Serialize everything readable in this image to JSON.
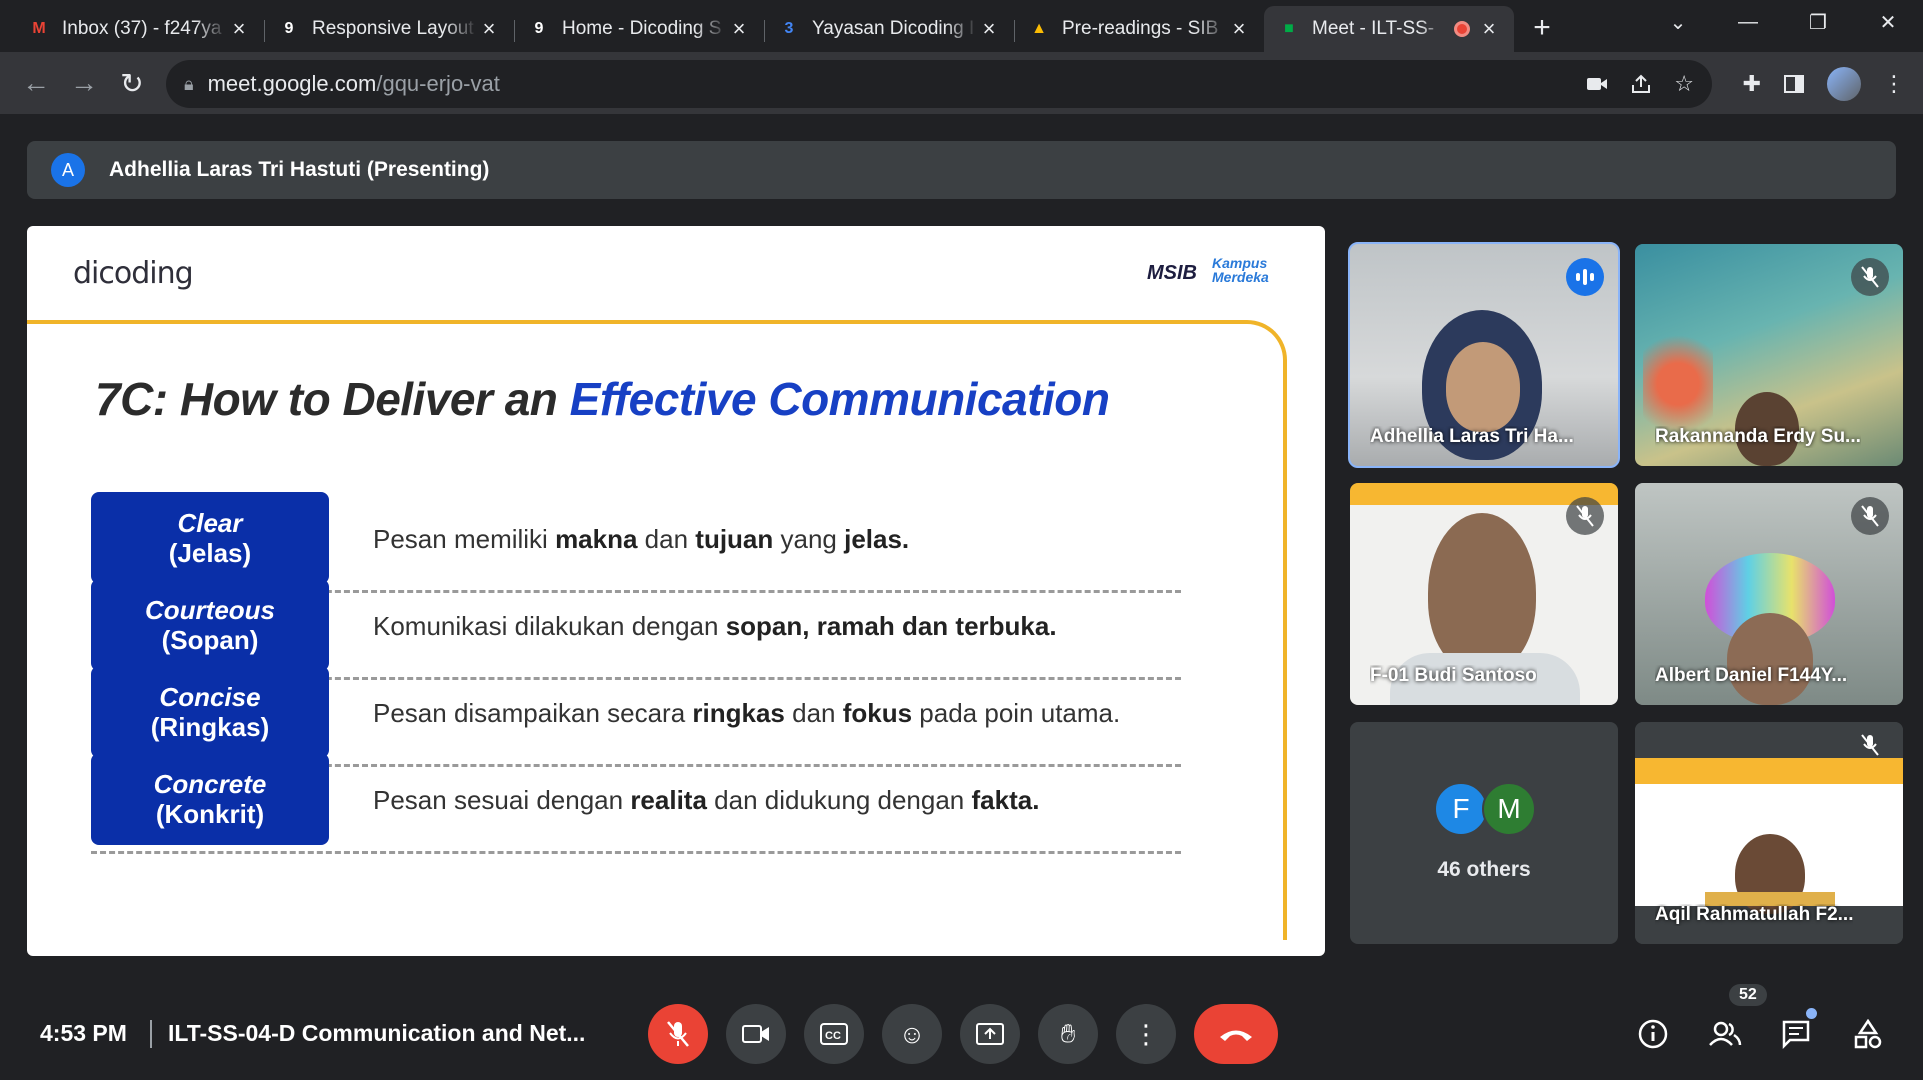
{
  "browser": {
    "tabs": [
      {
        "title": "Inbox (37) - f247ya",
        "icon": "gmail-icon",
        "active": false
      },
      {
        "title": "Responsive Layout",
        "icon": "dicoding-icon",
        "active": false
      },
      {
        "title": "Home - Dicoding S",
        "icon": "dicoding-icon",
        "active": false
      },
      {
        "title": "Yayasan Dicoding I",
        "icon": "calendar-icon",
        "active": false
      },
      {
        "title": "Pre-readings - SIB",
        "icon": "drive-icon",
        "active": false
      },
      {
        "title": "Meet - ILT-SS-",
        "icon": "meet-icon",
        "active": true
      }
    ],
    "url_host": "meet.google.com",
    "url_path": "/gqu-erjo-vat"
  },
  "presenter": {
    "initial": "A",
    "label": "Adhellia Laras Tri Hastuti (Presenting)"
  },
  "slide": {
    "logo_text": "dicoding",
    "msib_text": "MSIB",
    "kampus_text": "Kampus Merdeka",
    "title_plain": "7C: How to Deliver an ",
    "title_highlight": "Effective Communication",
    "items": [
      {
        "en": "Clear",
        "id": "(Jelas)",
        "desc": [
          [
            "Pesan memiliki ",
            false
          ],
          [
            "makna",
            true
          ],
          [
            " dan ",
            false
          ],
          [
            "tujuan",
            true
          ],
          [
            " yang ",
            false
          ],
          [
            "jelas.",
            true
          ]
        ]
      },
      {
        "en": "Courteous",
        "id": "(Sopan)",
        "desc": [
          [
            "Komunikasi dilakukan dengan ",
            false
          ],
          [
            "sopan, ramah dan terbuka.",
            true
          ]
        ]
      },
      {
        "en": "Concise",
        "id": "(Ringkas)",
        "desc": [
          [
            "Pesan disampaikan secara ",
            false
          ],
          [
            "ringkas",
            true
          ],
          [
            " dan ",
            false
          ],
          [
            "fokus",
            true
          ],
          [
            " pada poin utama.",
            false
          ]
        ]
      },
      {
        "en": "Concrete",
        "id": "(Konkrit)",
        "desc": [
          [
            "Pesan sesuai dengan ",
            false
          ],
          [
            "realita",
            true
          ],
          [
            " dan didukung dengan ",
            false
          ],
          [
            "fakta.",
            true
          ]
        ]
      }
    ]
  },
  "participants": [
    {
      "name": "Adhellia Laras Tri Ha...",
      "speaking": true
    },
    {
      "name": "Rakannanda Erdy Su...",
      "speaking": false
    },
    {
      "name": "F-01 Budi Santoso",
      "speaking": false
    },
    {
      "name": "Albert Daniel F144Y...",
      "speaking": false
    },
    {
      "name": "Aqil Rahmatullah F2...",
      "speaking": false
    }
  ],
  "others": {
    "label": "46 others",
    "avatars": [
      {
        "letter": "F",
        "color": "#1e88e5"
      },
      {
        "letter": "M",
        "color": "#2e7d32"
      }
    ]
  },
  "bottom": {
    "time": "4:53 PM",
    "meeting_title": "ILT-SS-04-D Communication and Net...",
    "participant_count": "52"
  },
  "colors": {
    "accent": "#8ab4f8",
    "danger": "#ea4335",
    "slide_blue": "#0a2fa8",
    "slide_gold": "#f0b429"
  }
}
